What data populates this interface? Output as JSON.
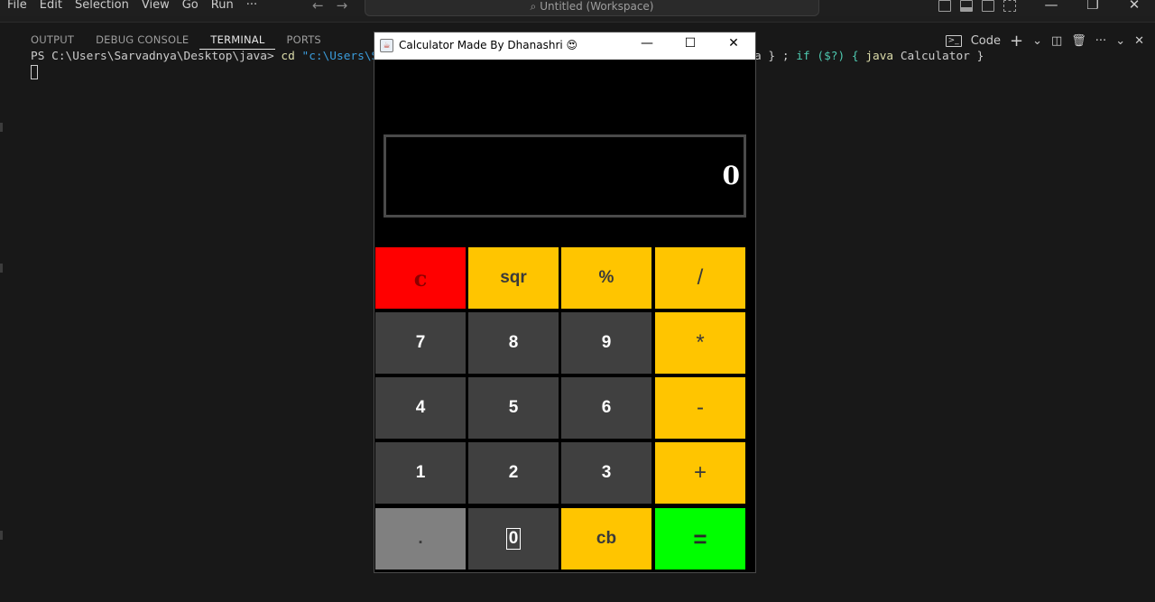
{
  "titlebar": {
    "menu": [
      "File",
      "Edit",
      "Selection",
      "View",
      "Go",
      "Run",
      "···"
    ],
    "back": "←",
    "forward": "→",
    "search_title": "Untitled (Workspace)",
    "window_controls": {
      "minimize": "—",
      "restore": "❐",
      "close": "✕"
    }
  },
  "panel": {
    "tabs": [
      "OUTPUT",
      "DEBUG CONSOLE",
      "TERMINAL",
      "PORTS"
    ],
    "active_tab": "TERMINAL",
    "actions": {
      "shell_label": "Code",
      "add": "+",
      "dropdown": "⌄",
      "more": "···",
      "collapse": "⌄",
      "close": "✕"
    }
  },
  "terminal": {
    "prompt": "PS C:\\Users\\Sarvadnya\\Desktop\\java> ",
    "cmd": "cd",
    "arg": " \"c:\\Users\\S",
    "tail_a": "a } ; ",
    "tail_if": "if",
    "tail_cond": " ($?) { ",
    "tail_java": "java",
    "tail_end": " Calculator }"
  },
  "calculator": {
    "title": "Calculator Made By Dhanashri 😍",
    "display_value": "0",
    "keys": [
      [
        "c",
        "sqr",
        "%",
        "/"
      ],
      [
        "7",
        "8",
        "9",
        "*"
      ],
      [
        "4",
        "5",
        "6",
        "-"
      ],
      [
        "1",
        "2",
        "3",
        "+"
      ],
      [
        ".",
        "0",
        "cb",
        "="
      ]
    ],
    "colors": {
      "yellow": "#ffc500",
      "red": "#ff0000",
      "dark": "#404040",
      "grey": "#808080",
      "green": "#00ff00"
    }
  }
}
